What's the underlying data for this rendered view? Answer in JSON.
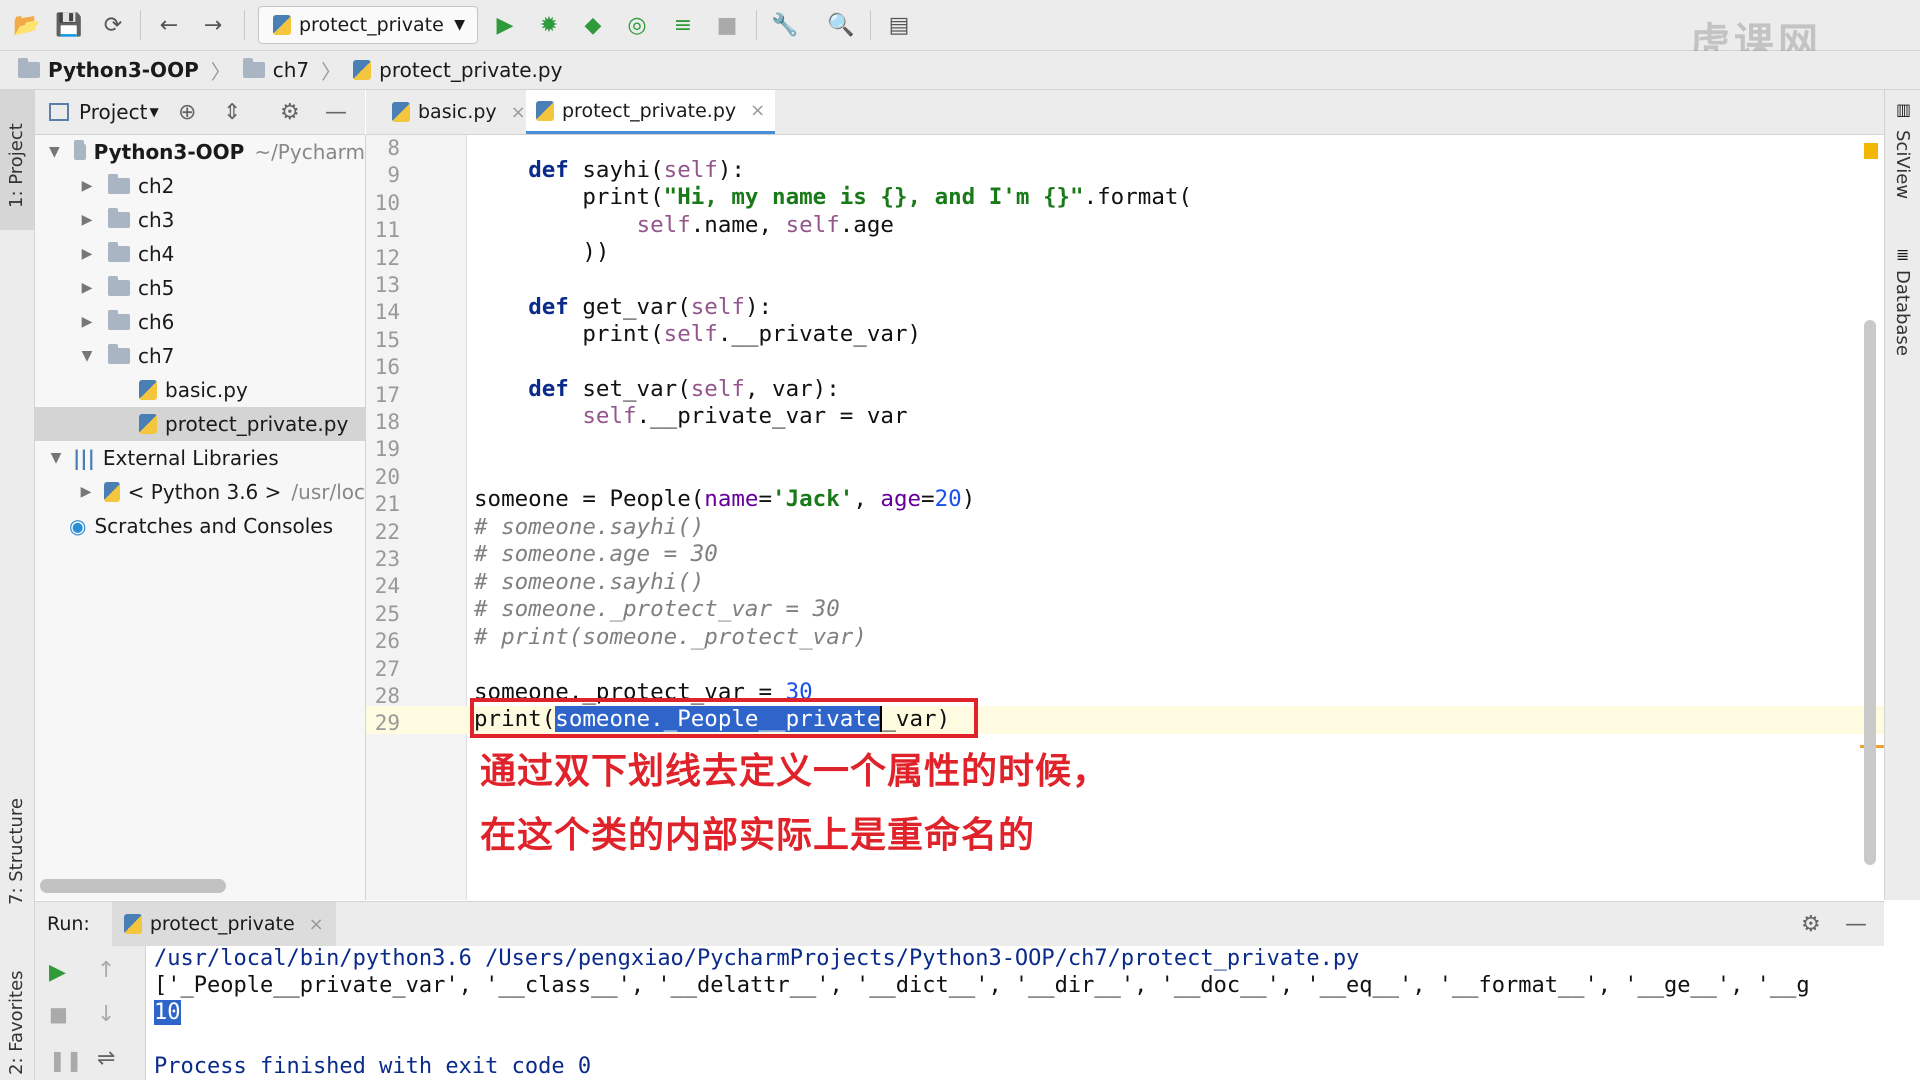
{
  "toolbar": {
    "run_config": "protect_private"
  },
  "breadcrumb": [
    "Python3-OOP",
    "ch7",
    "protect_private.py"
  ],
  "left_strip": {
    "project": "1: Project",
    "structure": "7: Structure",
    "favorites": "2: Favorites"
  },
  "right_strip": {
    "sciview": "SciView",
    "database": "Database"
  },
  "project_panel": {
    "title": "Project",
    "tree": [
      {
        "label": "Python3-OOP",
        "hint": "~/Pycharm",
        "indent": 0,
        "arrow": "▼",
        "icon": "folder",
        "bold": true
      },
      {
        "label": "ch2",
        "hint": "",
        "indent": 1,
        "arrow": "▶",
        "icon": "folder"
      },
      {
        "label": "ch3",
        "hint": "",
        "indent": 1,
        "arrow": "▶",
        "icon": "folder"
      },
      {
        "label": "ch4",
        "hint": "",
        "indent": 1,
        "arrow": "▶",
        "icon": "folder"
      },
      {
        "label": "ch5",
        "hint": "",
        "indent": 1,
        "arrow": "▶",
        "icon": "folder"
      },
      {
        "label": "ch6",
        "hint": "",
        "indent": 1,
        "arrow": "▶",
        "icon": "folder"
      },
      {
        "label": "ch7",
        "hint": "",
        "indent": 1,
        "arrow": "▼",
        "icon": "folder"
      },
      {
        "label": "basic.py",
        "hint": "",
        "indent": 2,
        "arrow": "",
        "icon": "py"
      },
      {
        "label": "protect_private.py",
        "hint": "",
        "indent": 2,
        "arrow": "",
        "icon": "py",
        "selected": true
      },
      {
        "label": "External Libraries",
        "hint": "",
        "indent": 0,
        "arrow": "▼",
        "icon": "lib"
      },
      {
        "label": "< Python 3.6 >",
        "hint": "/usr/loc",
        "indent": 1,
        "arrow": "▶",
        "icon": "python"
      },
      {
        "label": "Scratches and Consoles",
        "hint": "",
        "indent": 0,
        "arrow": "",
        "icon": "scratch"
      }
    ]
  },
  "tabs": [
    {
      "label": "basic.py",
      "active": false
    },
    {
      "label": "protect_private.py",
      "active": true
    }
  ],
  "editor": {
    "line_numbers": [
      "8",
      "9",
      "10",
      "11",
      "12",
      "13",
      "14",
      "15",
      "16",
      "17",
      "18",
      "19",
      "20",
      "21",
      "22",
      "23",
      "24",
      "25",
      "26",
      "27",
      "28",
      "29"
    ],
    "code": {
      "l9_def": "def",
      "l9_rest": " sayhi(",
      "l9_self": "self",
      "l9_end": "):",
      "l10_print": "print(",
      "l10_str": "\"Hi, my name is {}, and I'm {}\"",
      "l10_end": ".format(",
      "l11_self1": "self",
      "l11_mid": ".name, ",
      "l11_self2": "self",
      "l11_end": ".age",
      "l12": "))",
      "l14_def": "def",
      "l14_rest": " get_var(",
      "l14_self": "self",
      "l14_end": "):",
      "l15_a": "print(",
      "l15_self": "self",
      "l15_end": ".__private_var)",
      "l17_def": "def",
      "l17_rest": " set_var(",
      "l17_self": "self",
      "l17_end": ", var):",
      "l18_self": "self",
      "l18_end": ".__private_var = var",
      "l21_a": "someone = People(",
      "l21_name": "name",
      "l21_eq": "=",
      "l21_str": "'Jack'",
      "l21_c": ", ",
      "l21_age": "age",
      "l21_eq2": "=",
      "l21_num": "20",
      "l21_end": ")",
      "l22": "# someone.sayhi()",
      "l23": "# someone.age = 30",
      "l24": "# someone.sayhi()",
      "l25": "# someone._protect_var = 30",
      "l26": "# print(someone._protect_var)",
      "l28_a": "someone._protect_var = ",
      "l28_num": "30",
      "l29_a": "print(",
      "l29_sel": "someone._People__private",
      "l29_end": "_var)"
    },
    "annotation_line1": "通过双下划线去定义一个属性的时候，",
    "annotation_line2": "在这个类的内部实际上是重命名的"
  },
  "run_panel": {
    "label": "Run:",
    "tab": "protect_private",
    "output": [
      "/usr/local/bin/python3.6 /Users/pengxiao/PycharmProjects/Python3-OOP/ch7/protect_private.py",
      "['_People__private_var', '__class__', '__delattr__', '__dict__', '__dir__', '__doc__', '__eq__', '__format__', '__ge__', '__g",
      "10",
      "",
      "Process finished with exit code 0"
    ]
  },
  "watermark": "虎课网"
}
